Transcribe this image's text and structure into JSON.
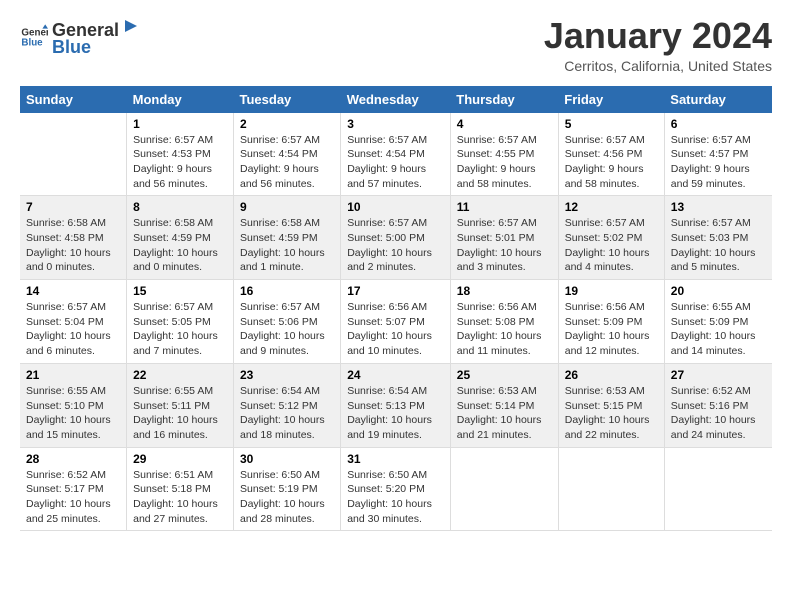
{
  "header": {
    "logo_general": "General",
    "logo_blue": "Blue",
    "month_year": "January 2024",
    "location": "Cerritos, California, United States"
  },
  "weekdays": [
    "Sunday",
    "Monday",
    "Tuesday",
    "Wednesday",
    "Thursday",
    "Friday",
    "Saturday"
  ],
  "weeks": [
    [
      {
        "day": "",
        "info": ""
      },
      {
        "day": "1",
        "info": "Sunrise: 6:57 AM\nSunset: 4:53 PM\nDaylight: 9 hours\nand 56 minutes."
      },
      {
        "day": "2",
        "info": "Sunrise: 6:57 AM\nSunset: 4:54 PM\nDaylight: 9 hours\nand 56 minutes."
      },
      {
        "day": "3",
        "info": "Sunrise: 6:57 AM\nSunset: 4:54 PM\nDaylight: 9 hours\nand 57 minutes."
      },
      {
        "day": "4",
        "info": "Sunrise: 6:57 AM\nSunset: 4:55 PM\nDaylight: 9 hours\nand 58 minutes."
      },
      {
        "day": "5",
        "info": "Sunrise: 6:57 AM\nSunset: 4:56 PM\nDaylight: 9 hours\nand 58 minutes."
      },
      {
        "day": "6",
        "info": "Sunrise: 6:57 AM\nSunset: 4:57 PM\nDaylight: 9 hours\nand 59 minutes."
      }
    ],
    [
      {
        "day": "7",
        "info": "Sunrise: 6:58 AM\nSunset: 4:58 PM\nDaylight: 10 hours\nand 0 minutes."
      },
      {
        "day": "8",
        "info": "Sunrise: 6:58 AM\nSunset: 4:59 PM\nDaylight: 10 hours\nand 0 minutes."
      },
      {
        "day": "9",
        "info": "Sunrise: 6:58 AM\nSunset: 4:59 PM\nDaylight: 10 hours\nand 1 minute."
      },
      {
        "day": "10",
        "info": "Sunrise: 6:57 AM\nSunset: 5:00 PM\nDaylight: 10 hours\nand 2 minutes."
      },
      {
        "day": "11",
        "info": "Sunrise: 6:57 AM\nSunset: 5:01 PM\nDaylight: 10 hours\nand 3 minutes."
      },
      {
        "day": "12",
        "info": "Sunrise: 6:57 AM\nSunset: 5:02 PM\nDaylight: 10 hours\nand 4 minutes."
      },
      {
        "day": "13",
        "info": "Sunrise: 6:57 AM\nSunset: 5:03 PM\nDaylight: 10 hours\nand 5 minutes."
      }
    ],
    [
      {
        "day": "14",
        "info": "Sunrise: 6:57 AM\nSunset: 5:04 PM\nDaylight: 10 hours\nand 6 minutes."
      },
      {
        "day": "15",
        "info": "Sunrise: 6:57 AM\nSunset: 5:05 PM\nDaylight: 10 hours\nand 7 minutes."
      },
      {
        "day": "16",
        "info": "Sunrise: 6:57 AM\nSunset: 5:06 PM\nDaylight: 10 hours\nand 9 minutes."
      },
      {
        "day": "17",
        "info": "Sunrise: 6:56 AM\nSunset: 5:07 PM\nDaylight: 10 hours\nand 10 minutes."
      },
      {
        "day": "18",
        "info": "Sunrise: 6:56 AM\nSunset: 5:08 PM\nDaylight: 10 hours\nand 11 minutes."
      },
      {
        "day": "19",
        "info": "Sunrise: 6:56 AM\nSunset: 5:09 PM\nDaylight: 10 hours\nand 12 minutes."
      },
      {
        "day": "20",
        "info": "Sunrise: 6:55 AM\nSunset: 5:09 PM\nDaylight: 10 hours\nand 14 minutes."
      }
    ],
    [
      {
        "day": "21",
        "info": "Sunrise: 6:55 AM\nSunset: 5:10 PM\nDaylight: 10 hours\nand 15 minutes."
      },
      {
        "day": "22",
        "info": "Sunrise: 6:55 AM\nSunset: 5:11 PM\nDaylight: 10 hours\nand 16 minutes."
      },
      {
        "day": "23",
        "info": "Sunrise: 6:54 AM\nSunset: 5:12 PM\nDaylight: 10 hours\nand 18 minutes."
      },
      {
        "day": "24",
        "info": "Sunrise: 6:54 AM\nSunset: 5:13 PM\nDaylight: 10 hours\nand 19 minutes."
      },
      {
        "day": "25",
        "info": "Sunrise: 6:53 AM\nSunset: 5:14 PM\nDaylight: 10 hours\nand 21 minutes."
      },
      {
        "day": "26",
        "info": "Sunrise: 6:53 AM\nSunset: 5:15 PM\nDaylight: 10 hours\nand 22 minutes."
      },
      {
        "day": "27",
        "info": "Sunrise: 6:52 AM\nSunset: 5:16 PM\nDaylight: 10 hours\nand 24 minutes."
      }
    ],
    [
      {
        "day": "28",
        "info": "Sunrise: 6:52 AM\nSunset: 5:17 PM\nDaylight: 10 hours\nand 25 minutes."
      },
      {
        "day": "29",
        "info": "Sunrise: 6:51 AM\nSunset: 5:18 PM\nDaylight: 10 hours\nand 27 minutes."
      },
      {
        "day": "30",
        "info": "Sunrise: 6:50 AM\nSunset: 5:19 PM\nDaylight: 10 hours\nand 28 minutes."
      },
      {
        "day": "31",
        "info": "Sunrise: 6:50 AM\nSunset: 5:20 PM\nDaylight: 10 hours\nand 30 minutes."
      },
      {
        "day": "",
        "info": ""
      },
      {
        "day": "",
        "info": ""
      },
      {
        "day": "",
        "info": ""
      }
    ]
  ]
}
